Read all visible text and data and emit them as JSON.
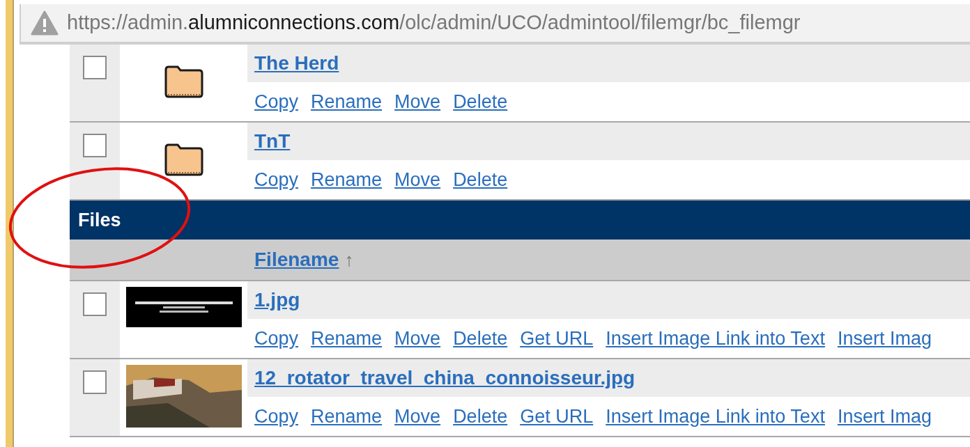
{
  "address_bar": {
    "scheme": "https://admin.",
    "domain": "alumniconnections.com",
    "path": "/olc/admin/UCO/admintool/filemgr/bc_filemgr"
  },
  "folders": [
    {
      "name": "The Herd",
      "checked": false,
      "actions": [
        "Copy",
        "Rename",
        "Move",
        "Delete"
      ]
    },
    {
      "name": "TnT",
      "checked": false,
      "actions": [
        "Copy",
        "Rename",
        "Move",
        "Delete"
      ]
    }
  ],
  "files_section": {
    "title": "Files",
    "column": "Filename",
    "sort_indicator": "↑"
  },
  "files": [
    {
      "name": "1.jpg",
      "checked": false,
      "kind": "banner",
      "actions": [
        "Copy",
        "Rename",
        "Move",
        "Delete",
        "Get URL",
        "Insert Image Link into Text",
        "Insert Imag"
      ]
    },
    {
      "name": "12_rotator_travel_china_connoisseur.jpg",
      "checked": false,
      "kind": "photo",
      "actions": [
        "Copy",
        "Rename",
        "Move",
        "Delete",
        "Get URL",
        "Insert Image Link into Text",
        "Insert Imag"
      ]
    }
  ],
  "annotation": {
    "kind": "ellipse",
    "color": "#e01010"
  }
}
